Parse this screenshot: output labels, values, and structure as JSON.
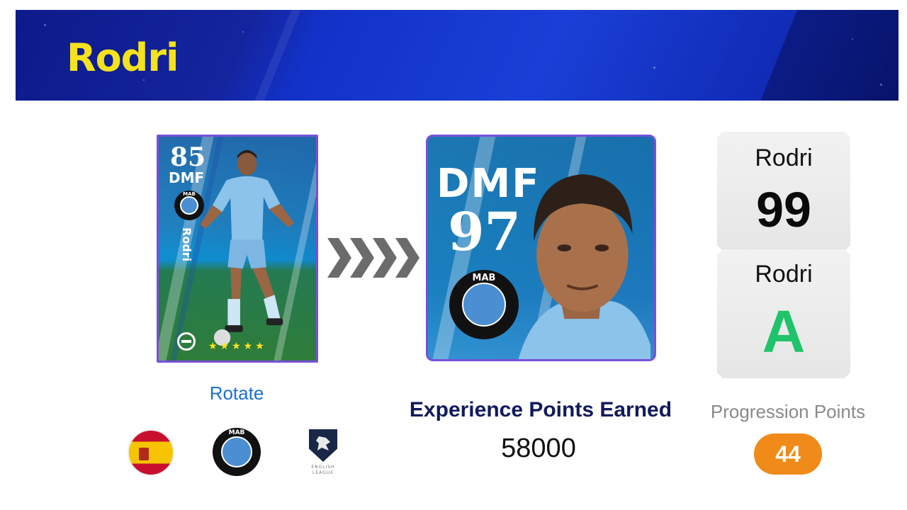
{
  "header": {
    "player_name": "Rodri"
  },
  "current_card": {
    "rating": "85",
    "position": "DMF",
    "name": "Rodri",
    "stars": "★★★★★"
  },
  "upgraded_card": {
    "position": "DMF",
    "rating": "97"
  },
  "club_badge": {
    "text": "MAB"
  },
  "stats": {
    "box1": {
      "name": "Rodri",
      "value": "99"
    },
    "box2": {
      "name": "Rodri",
      "value": "A"
    }
  },
  "actions": {
    "rotate_label": "Rotate"
  },
  "experience": {
    "label": "Experience Points Earned",
    "value": "58000"
  },
  "progression": {
    "label": "Progression Points",
    "value": "44"
  },
  "league": {
    "text": "ENGLISH LEAGUE"
  },
  "colors": {
    "banner_blue": "#1a3fd6",
    "title_yellow": "#f4e21c",
    "card_blue": "#1aa6e0",
    "grade_green": "#1fc36a",
    "progression_orange": "#f08a18",
    "rotate_blue": "#1b6fd6"
  }
}
